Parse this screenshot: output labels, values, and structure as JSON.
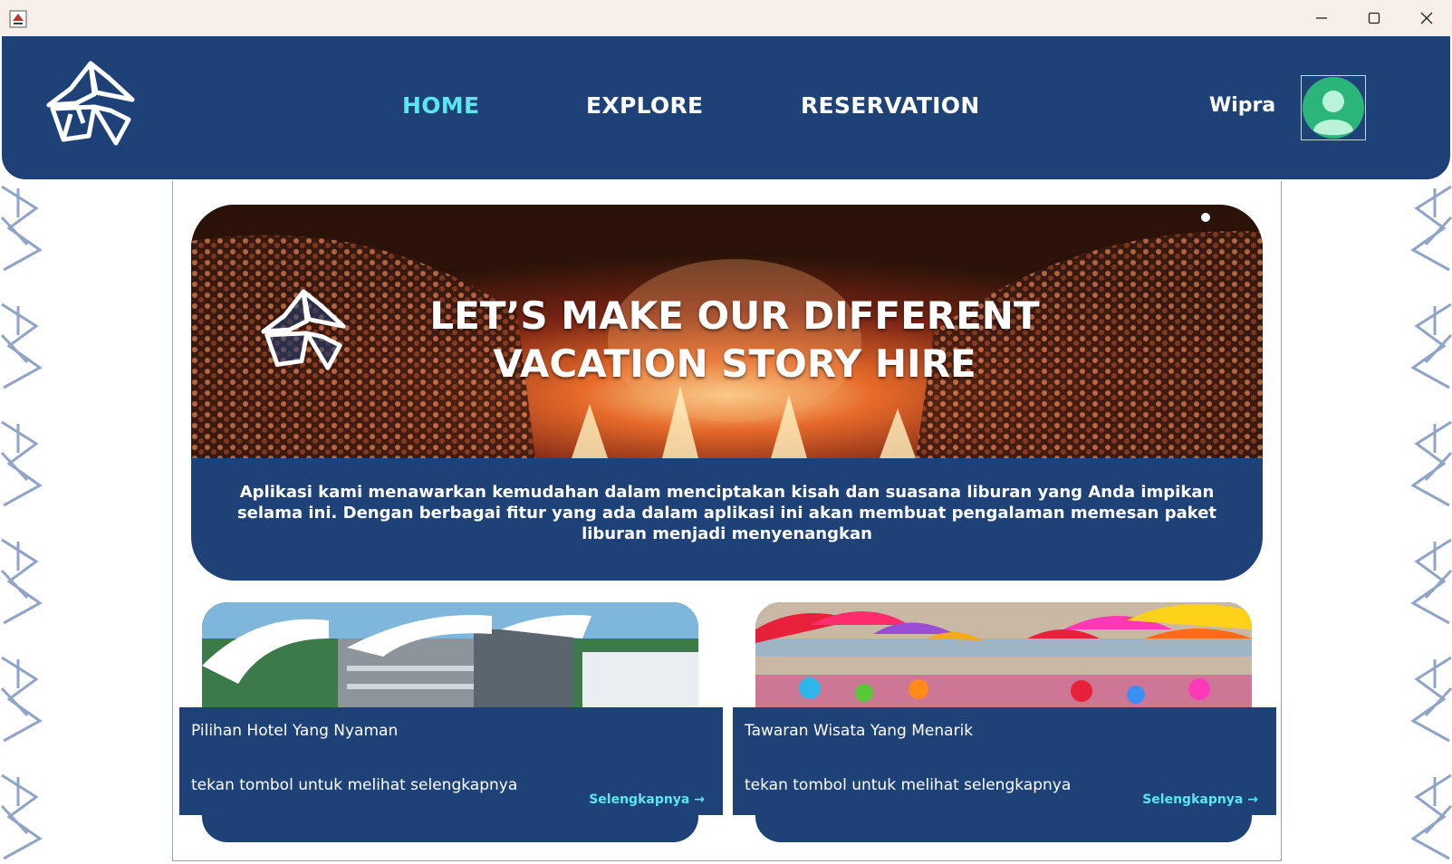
{
  "window": {
    "app_icon": "java-app-icon",
    "controls": {
      "minimize": "minimize-icon",
      "maximize": "maximize-icon",
      "close": "close-icon"
    }
  },
  "nav": {
    "logo": "origami-bird-logo",
    "items": [
      {
        "label": "HOME",
        "active": true
      },
      {
        "label": "EXPLORE",
        "active": false
      },
      {
        "label": "RESERVATION",
        "active": false
      }
    ],
    "username": "Wipra",
    "avatar": "user-avatar-icon"
  },
  "hero": {
    "title_line1": "LET’S MAKE OUR DIFFERENT",
    "title_line2": "VACATION STORY HIRE",
    "description": "Aplikasi kami menawarkan kemudahan dalam menciptakan kisah dan suasana liburan yang Anda impikan selama ini. Dengan berbagai fitur yang ada dalam aplikasi ini akan membuat pengalaman memesan paket liburan menjadi menyenangkan"
  },
  "cards": [
    {
      "title": "Pilihan Hotel Yang Nyaman",
      "subtitle": "tekan tombol untuk melihat selengkapnya",
      "link": "Selengkapnya →"
    },
    {
      "title": "Tawaran Wisata Yang Menarik",
      "subtitle": "tekan tombol untuk melihat selengkapnya",
      "link": "Selengkapnya →"
    }
  ],
  "colors": {
    "navy": "#1e4278",
    "accent": "#5be6f0",
    "titlebar": "#f6efe9"
  }
}
